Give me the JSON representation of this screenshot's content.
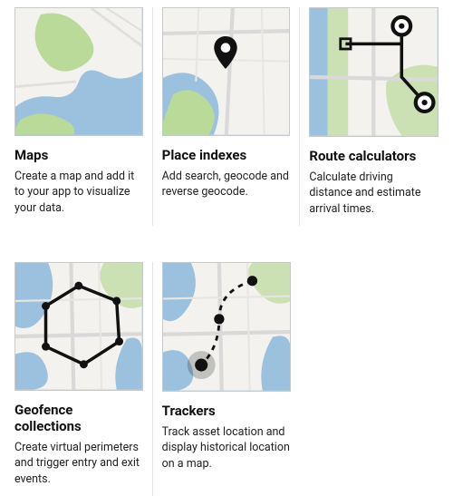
{
  "cards": [
    {
      "title": "Maps",
      "desc": "Create a map and add it to your app to visualize your data."
    },
    {
      "title": "Place indexes",
      "desc": "Add search, geocode and reverse geocode."
    },
    {
      "title": "Route calculators",
      "desc": "Calculate driving distance and estimate arrival times."
    },
    {
      "title": "Geofence collections",
      "desc": "Create virtual perimeters and trigger entry and exit events."
    },
    {
      "title": "Trackers",
      "desc": "Track asset location and display historical location on a map."
    }
  ],
  "colors": {
    "water": "#9cc1de",
    "land": "#f3f2ee",
    "park": "#bada9a",
    "road": "#d9d9d9",
    "road2": "#e7e6e2",
    "dark": "#111111"
  }
}
